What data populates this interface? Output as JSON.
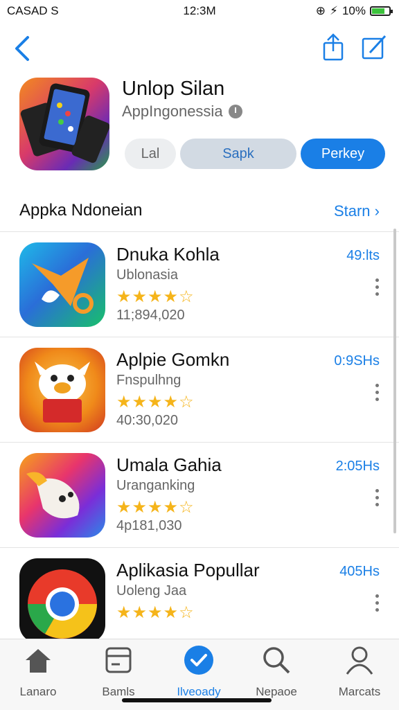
{
  "status": {
    "carrier": "CASAD S",
    "time": "12:3M",
    "battery": "10%"
  },
  "app": {
    "title": "Unlop Silan",
    "developer": "AppIngonessia",
    "buttons": [
      "Lal",
      "Sapk",
      "Perkey"
    ]
  },
  "section": {
    "title": "Appka Ndoneian",
    "link": "Starn"
  },
  "apps": [
    {
      "name": "Dnuka Kohla",
      "sub": "Ublonasia",
      "stars": "★★★★☆",
      "count": "11;894,020",
      "size": "49:lts"
    },
    {
      "name": "Aplpie Gomkn",
      "sub": "Fnspulhng",
      "stars": "★★★★☆",
      "count": "40:30,020",
      "size": "0:9SHs"
    },
    {
      "name": "Umala Gahia",
      "sub": "Uranganking",
      "stars": "★★★★☆",
      "count": "4p181,030",
      "size": "2:05Hs"
    },
    {
      "name": "Aplikasia Popullar",
      "sub": "Uoleng Jaa",
      "stars": "★★★★☆",
      "count": "",
      "size": "405Hs"
    }
  ],
  "tabs": [
    "Lanaro",
    "Bamls",
    "Ilveoady",
    "Nepaoe",
    "Marcats"
  ],
  "colors": {
    "accent": "#1a7fe6",
    "star": "#f5b41a"
  }
}
